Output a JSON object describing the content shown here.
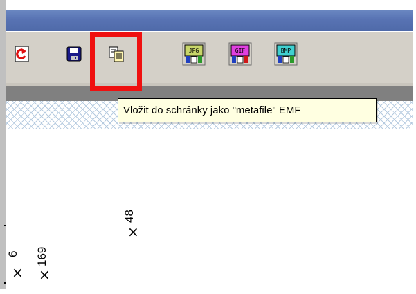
{
  "window": {
    "title": ""
  },
  "toolbar": {
    "buttons": [
      {
        "name": "refresh",
        "icon": "refresh-icon",
        "tooltip": ""
      },
      {
        "name": "save",
        "icon": "floppy-disk-icon",
        "tooltip": ""
      },
      {
        "name": "copy-emf",
        "icon": "copy-clipboard-icon",
        "tooltip": "Vložit do schránky jako \"metafile\" EMF",
        "highlighted": true
      },
      {
        "name": "export-jpg",
        "icon": "jpg-export-icon",
        "label": "JPG"
      },
      {
        "name": "export-gif",
        "icon": "gif-export-icon",
        "label": "GIF"
      },
      {
        "name": "export-bmp",
        "icon": "bmp-export-icon",
        "label": "BMP"
      }
    ]
  },
  "tooltip": {
    "text": "Vložit do schránky jako \"metafile\" EMF"
  },
  "plot": {
    "points": [
      {
        "label": "48",
        "marker": "×"
      },
      {
        "label": "169",
        "marker": "×"
      },
      {
        "label": "6",
        "marker": "×"
      }
    ]
  },
  "colors": {
    "highlight": "#ef1010",
    "titlebar": "#5873b3",
    "toolbar": "#d4d0c8",
    "tooltip_bg": "#ffffe1"
  }
}
